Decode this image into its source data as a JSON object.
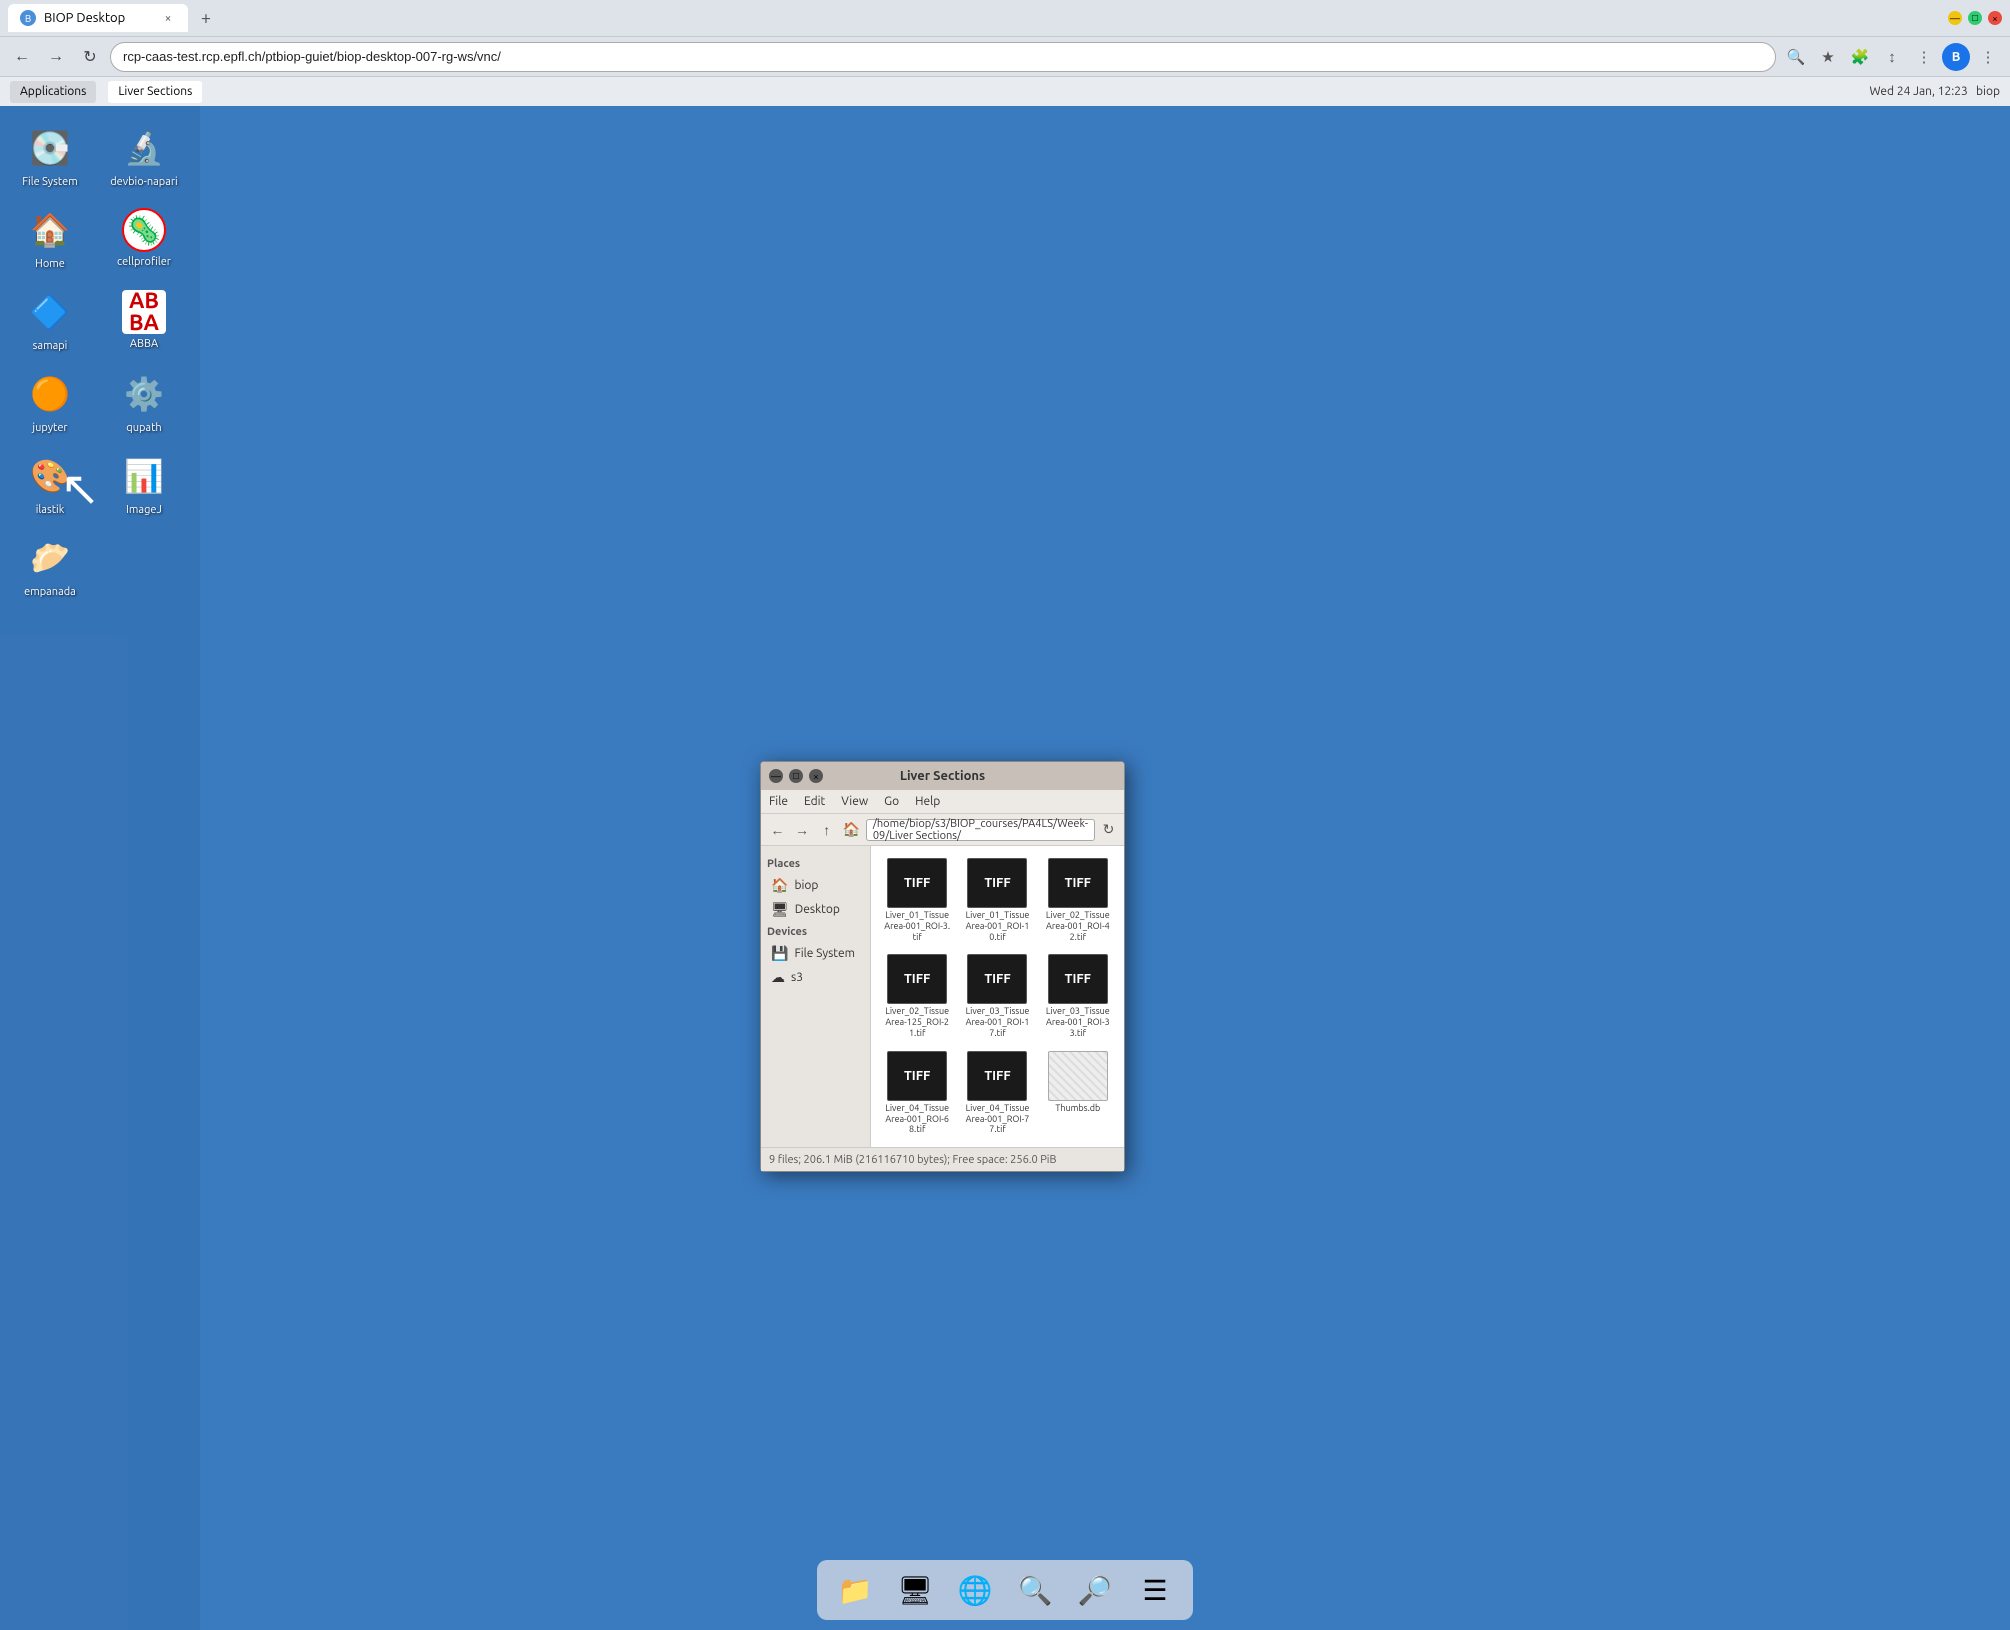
{
  "browser": {
    "tab_title": "BIOP Desktop",
    "url": "rcp-caas-test.rcp.epfl.ch/ptbiop-guiet/biop-desktop-007-rg-ws/vnc/",
    "new_tab_label": "+",
    "close_label": "×",
    "back_label": "←",
    "forward_label": "→",
    "reload_label": "↻",
    "profile_initial": "B"
  },
  "app_toolbar": {
    "applications_label": "Applications",
    "tab_label": "Liver Sections",
    "datetime": "Wed 24 Jan, 12:23",
    "user": "biop"
  },
  "desktop": {
    "icons": [
      {
        "id": "filesystem",
        "label": "File System",
        "icon": "💾"
      },
      {
        "id": "devbio-napari",
        "label": "devbio-napari",
        "icon": "🔬"
      },
      {
        "id": "home",
        "label": "Home",
        "icon": "🏠"
      },
      {
        "id": "cellprofiler",
        "label": "cellprofiler",
        "icon": "🧬"
      },
      {
        "id": "samapi",
        "label": "samapi",
        "icon": "🔷"
      },
      {
        "id": "abba",
        "label": "ABBA",
        "icon": "🔤"
      },
      {
        "id": "jupyter",
        "label": "jupyter",
        "icon": "🟠"
      },
      {
        "id": "qupath",
        "label": "qupath",
        "icon": "⚙"
      },
      {
        "id": "ilastik",
        "label": "ilastik",
        "icon": "🎨"
      },
      {
        "id": "imagej",
        "label": "ImageJ",
        "icon": "📊"
      },
      {
        "id": "empanada",
        "label": "empanada",
        "icon": "🟡"
      }
    ]
  },
  "file_manager": {
    "title": "Liver Sections",
    "path": "/home/biop/s3/BIOP_courses/PA4LS/Week-09/Liver Sections/",
    "menu": {
      "file": "File",
      "edit": "Edit",
      "view": "View",
      "go": "Go",
      "help": "Help"
    },
    "places": {
      "header": "Places",
      "biop": "biop",
      "desktop": "Desktop"
    },
    "devices": {
      "header": "Devices",
      "filesystem": "File System",
      "s3": "s3"
    },
    "files": [
      {
        "id": "f1",
        "name": "Liver_01_TissueArea-001_ROI-3.tif",
        "type": "TIFF"
      },
      {
        "id": "f2",
        "name": "Liver_01_TissueArea-001_ROI-10.tif",
        "type": "TIFF"
      },
      {
        "id": "f3",
        "name": "Liver_02_TissueArea-001_ROI-42.tif",
        "type": "TIFF"
      },
      {
        "id": "f4",
        "name": "Liver_02_TissueArea-125_ROI-21.tif",
        "type": "TIFF"
      },
      {
        "id": "f5",
        "name": "Liver_03_TissueArea-001_ROI-17.tif",
        "type": "TIFF"
      },
      {
        "id": "f6",
        "name": "Liver_03_TissueArea-001_ROI-33.tif",
        "type": "TIFF"
      },
      {
        "id": "f7",
        "name": "Liver_04_TissueArea-001_ROI-68.tif",
        "type": "TIFF"
      },
      {
        "id": "f8",
        "name": "Liver_04_TissueArea-001_ROI-77.tif",
        "type": "TIFF"
      },
      {
        "id": "f9",
        "name": "Thumbs.db",
        "type": "DB"
      }
    ],
    "statusbar": "9 files; 206.1 MiB (216116710 bytes); Free space: 256.0 PiB",
    "win_btns": {
      "minimize": "—",
      "maximize": "□",
      "close": "×"
    }
  },
  "taskbar": {
    "items": [
      {
        "id": "files",
        "icon": "📁"
      },
      {
        "id": "terminal",
        "icon": "🖥"
      },
      {
        "id": "browser",
        "icon": "🌐"
      },
      {
        "id": "search",
        "icon": "🔍"
      },
      {
        "id": "magnifier",
        "icon": "🔎"
      },
      {
        "id": "menu",
        "icon": "☰"
      }
    ]
  }
}
